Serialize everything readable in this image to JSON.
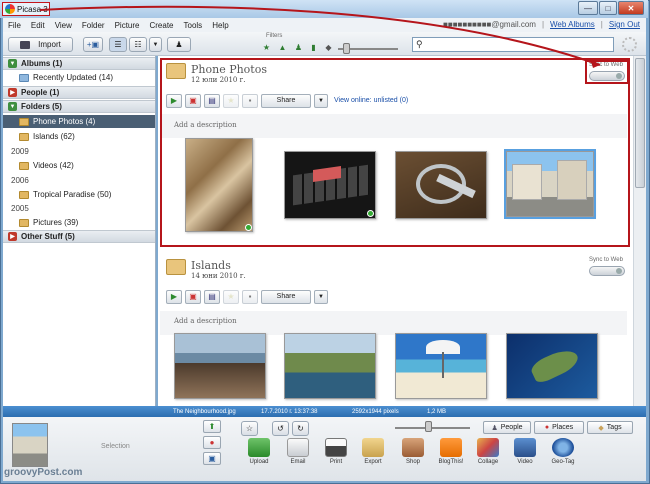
{
  "window": {
    "title": "Picasa 3"
  },
  "menu": {
    "items": [
      "File",
      "Edit",
      "View",
      "Folder",
      "Picture",
      "Create",
      "Tools",
      "Help"
    ],
    "account": "■■■■■■■■■■@gmail.com",
    "separator": "|",
    "web_albums": "Web Albums",
    "sign_out": "Sign Out"
  },
  "toolbar": {
    "import_label": "Import",
    "filters_label": "Filters",
    "search_placeholder": ""
  },
  "sidebar": {
    "albums": "Albums (1)",
    "recently_updated": "Recently Updated (14)",
    "people": "People (1)",
    "folders": "Folders (5)",
    "phone_photos": "Phone Photos (4)",
    "islands": "Islands (62)",
    "year_2009": "2009",
    "videos": "Videos (42)",
    "year_2006": "2006",
    "tropical": "Tropical Paradise (50)",
    "year_2005": "2005",
    "pictures": "Pictures (39)",
    "other_stuff": "Other Stuff (5)"
  },
  "albums": [
    {
      "title": "Phone Photos",
      "date": "12 юли 2010 г.",
      "sync_label": "Sync to Web",
      "share_label": "Share",
      "view_online": "View online: unlisted (0)",
      "description": "Add a description"
    },
    {
      "title": "Islands",
      "date": "14 юни 2010 г.",
      "sync_label": "Sync to Web",
      "share_label": "Share",
      "description": "Add a description"
    }
  ],
  "status": {
    "filename": "The Neighbourhood.jpg",
    "datetime": "17.7.2010 г. 13:37:38",
    "dimensions": "2592x1944 pixels",
    "size": "1,2 MB"
  },
  "tray": {
    "selection_label": "Selection",
    "people_label": "People",
    "places_label": "Places",
    "tags_label": "Tags",
    "tools": [
      "Upload",
      "Email",
      "Print",
      "Export",
      "Shop",
      "BlogThis!",
      "Collage",
      "Video",
      "Geo-Tag"
    ]
  },
  "watermark": "groovyPost.com",
  "colors": {
    "annotation_red": "#b5151b",
    "selection_blue": "#4a5f74",
    "status_blue": "#2c6db0"
  }
}
